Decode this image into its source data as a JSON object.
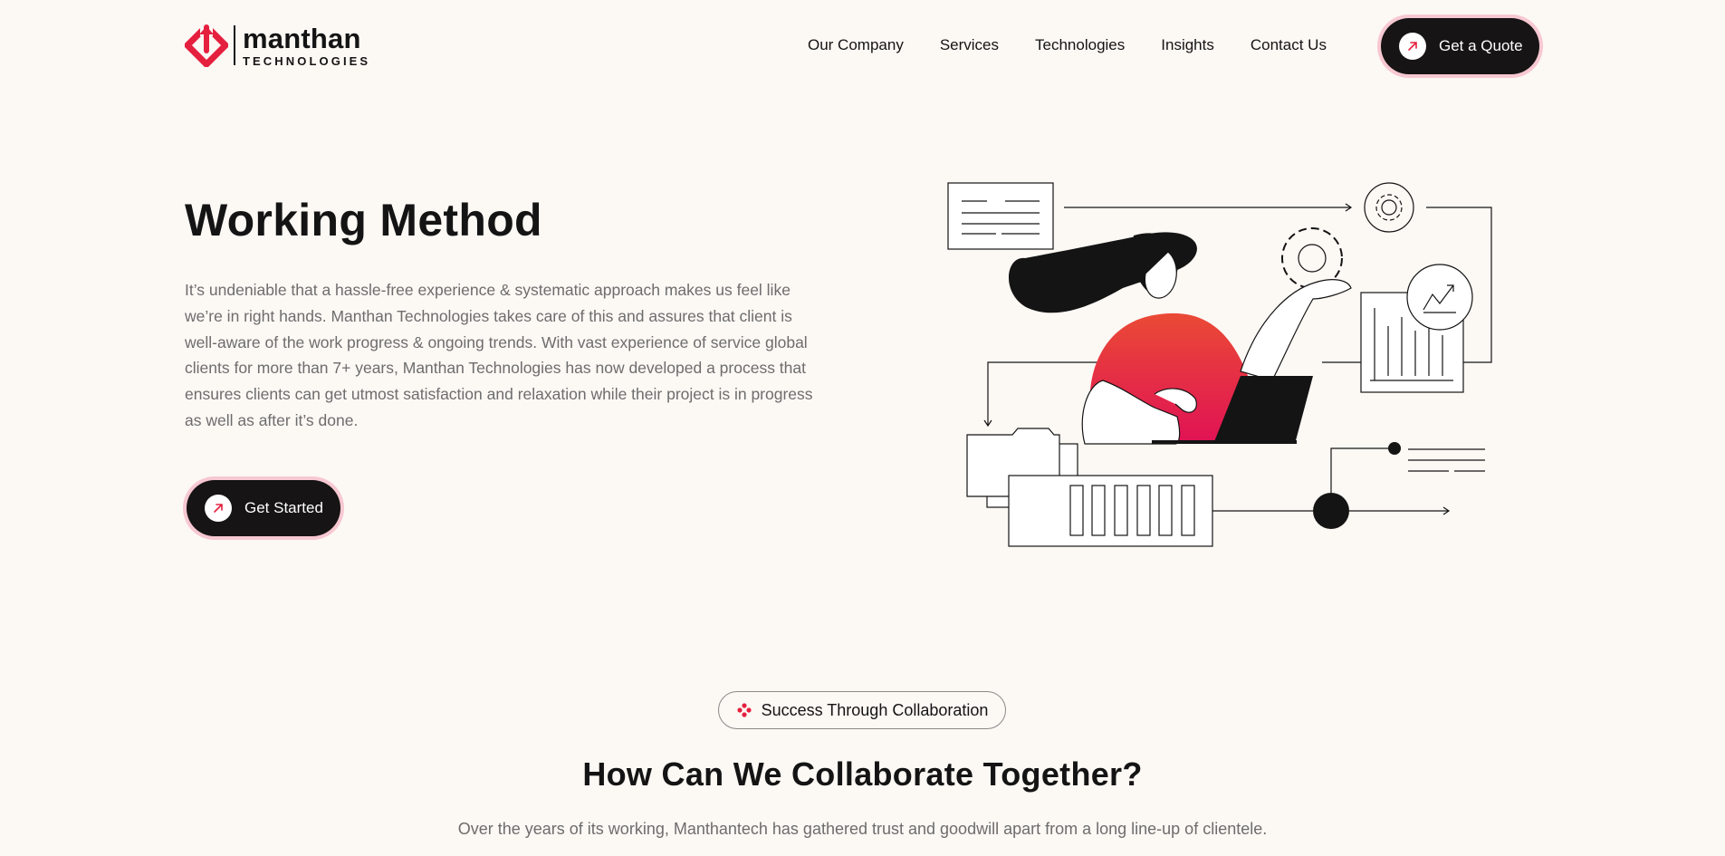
{
  "brand": {
    "name": "manthan",
    "sub": "TECHNOLOGIES",
    "accent_color": "#e5203f",
    "dark_color": "#161414",
    "glow_color": "#f7c8d2"
  },
  "nav": {
    "items": [
      "Our Company",
      "Services",
      "Technologies",
      "Insights",
      "Contact Us"
    ],
    "cta_label": "Get a Quote",
    "cta_icon": "arrow-up-right-icon"
  },
  "hero": {
    "title": "Working Method",
    "description": "It’s undeniable that a hassle-free experience & systematic approach makes us feel like we’re in right hands. Manthan Technologies takes care of this and assures that client is well-aware of the work progress & ongoing trends. With vast experience of service global clients for more than 7+ years, Manthan Technologies has now developed a process that ensures clients can get utmost satisfaction and relaxation while their project is in progress as well as after it’s done.",
    "cta_label": "Get Started",
    "illustration": "woman-with-laptop-workflow-illustration"
  },
  "collab": {
    "badge_label": "Success Through Collaboration",
    "badge_icon": "manthan-mark-icon",
    "title": "How Can We Collaborate Together?",
    "description": "Over the years of its working, Manthantech has gathered trust and goodwill apart from a long line-up of clientele."
  }
}
